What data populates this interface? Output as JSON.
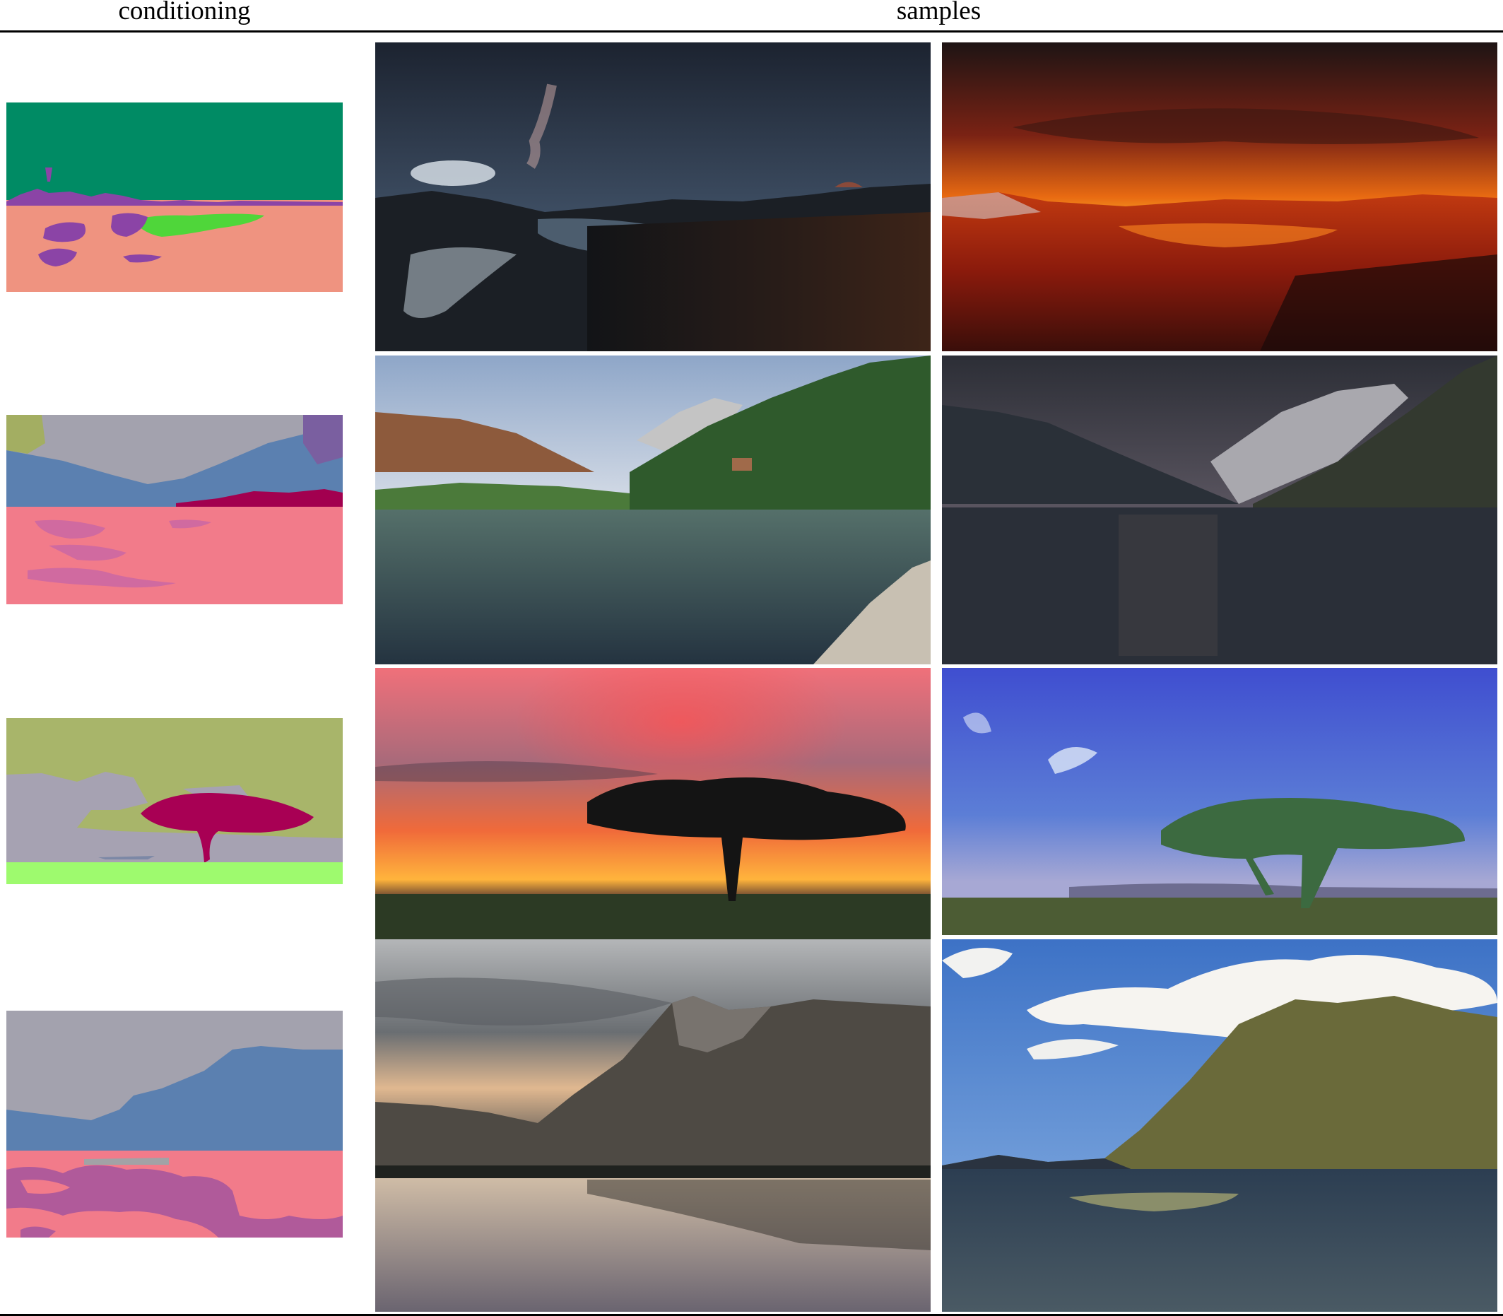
{
  "header": {
    "conditioning": "conditioning",
    "samples": "samples"
  },
  "rows": [
    {
      "conditioning": "segmentation-map",
      "samples": [
        "night-sky-lake-sample",
        "red-sunset-volcanic-sample"
      ]
    },
    {
      "conditioning": "segmentation-map",
      "samples": [
        "mountain-lake-day-sample",
        "dark-fjord-sample"
      ]
    },
    {
      "conditioning": "segmentation-map",
      "samples": [
        "sunset-tree-silhouette-sample",
        "blue-sky-tree-sample"
      ]
    },
    {
      "conditioning": "segmentation-map",
      "samples": [
        "mountain-reflection-sample",
        "cloudy-mountain-lake-sample"
      ]
    }
  ]
}
